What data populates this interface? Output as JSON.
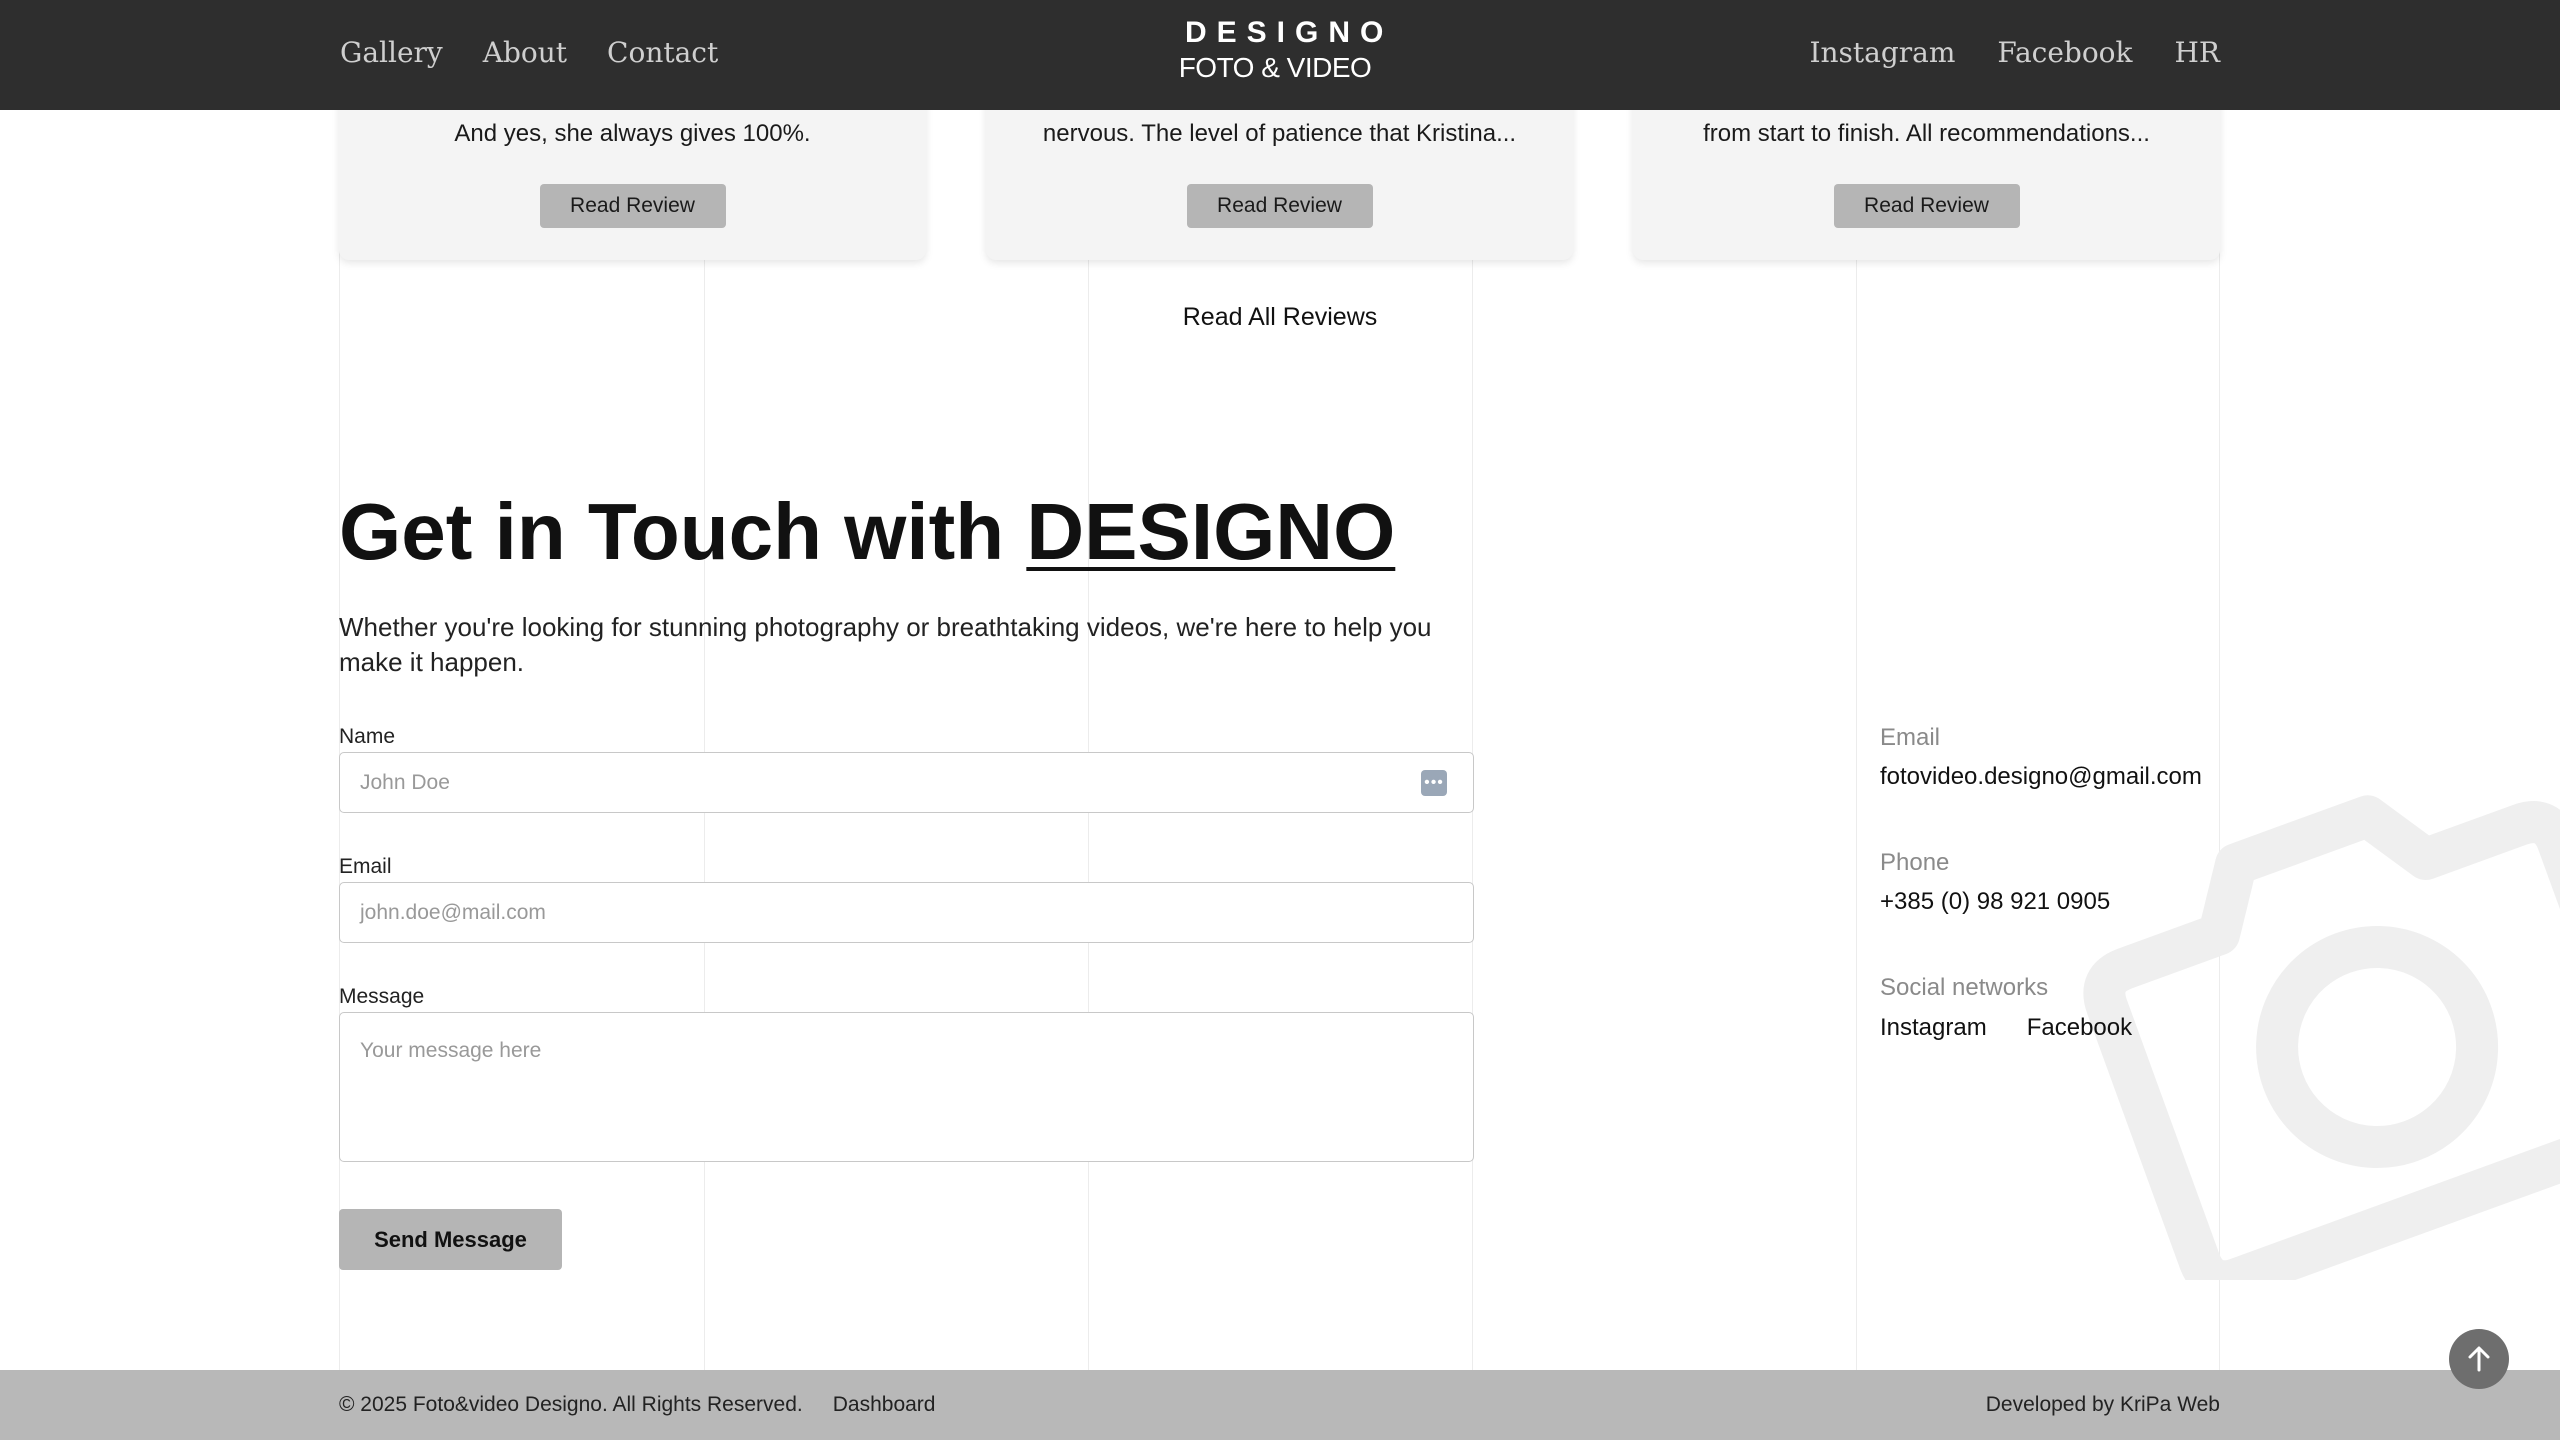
{
  "header": {
    "nav_left": [
      "Gallery",
      "About",
      "Contact"
    ],
    "nav_right": [
      "Instagram",
      "Facebook",
      "HR"
    ],
    "logo_title": "DESIGNO",
    "logo_subtitle": "FOTO & VIDEO"
  },
  "reviews": [
    {
      "excerpt_top": "",
      "excerpt": "And yes, she always gives 100%.",
      "button": "Read Review"
    },
    {
      "excerpt_top": "",
      "excerpt": "nervous. The level of patience that Kristina...",
      "button": "Read Review"
    },
    {
      "excerpt_top": "",
      "excerpt": "from start to finish. All recommendations...",
      "button": "Read Review"
    }
  ],
  "read_all_reviews": "Read All Reviews",
  "contact": {
    "title_prefix": "Get in Touch with ",
    "title_brand": "DESIGNO",
    "description": "Whether you're looking for stunning photography or breathtaking videos, we're here to help you make it happen.",
    "name_label": "Name",
    "name_placeholder": "John Doe",
    "email_label": "Email",
    "email_placeholder": "john.doe@mail.com",
    "message_label": "Message",
    "message_placeholder": "Your message here",
    "send_button": "Send Message"
  },
  "info": {
    "email_label": "Email",
    "email_value": "fotovideo.designo@gmail.com",
    "phone_label": "Phone",
    "phone_value": "+385 (0) 98 921 0905",
    "social_label": "Social networks",
    "social_links": [
      "Instagram",
      "Facebook"
    ]
  },
  "footer": {
    "copyright": "© 2025 Foto&video Designo. All Rights Reserved.",
    "dashboard": "Dashboard",
    "developed_by": "Developed by KriPa Web"
  },
  "icons": {
    "watermark": "camera-icon",
    "autofill": "more-dots-icon",
    "scroll_top": "arrow-up-icon"
  },
  "colors": {
    "header_bg": "#2e2e2e",
    "footer_bg": "#b8b8b8",
    "button_bg": "#b5b5b5"
  }
}
